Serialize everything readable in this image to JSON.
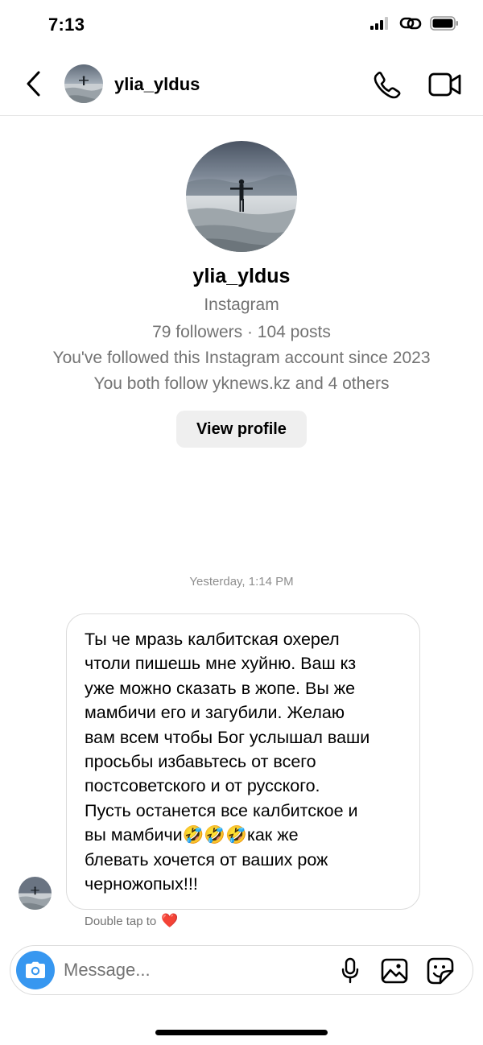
{
  "status_bar": {
    "time": "7:13"
  },
  "header": {
    "username": "ylia_yldus"
  },
  "profile": {
    "name": "ylia_yldus",
    "platform": "Instagram",
    "stats": "79 followers · 104 posts",
    "followed_since": "You've followed this Instagram account since 2023",
    "mutual": "You both follow yknews.kz and 4 others",
    "view_profile_label": "View profile"
  },
  "chat": {
    "timestamp": "Yesterday, 1:14 PM",
    "messages": [
      {
        "text": "Ты че мразь калбитская охерел\nчтоли пишешь мне хуйню. Ваш кз\nуже можно сказать в жопе. Вы же\nмамбичи его и загубили. Желаю\nвам всем чтобы Бог услышал ваши\nпросьбы избавьтесь от всего\nпостсоветского и от русского.\nПусть останется все калбитское и\nвы мамбичи🤣🤣🤣как же\nблевать хочется от ваших рож\nчерножопых!!!"
      }
    ],
    "double_tap_hint": "Double tap to",
    "double_tap_emoji": "❤️"
  },
  "composer": {
    "placeholder": "Message..."
  },
  "icons": {
    "back": "chevron-left-icon",
    "call": "phone-icon",
    "video": "video-camera-icon",
    "camera": "camera-icon",
    "mic": "microphone-icon",
    "gallery": "image-icon",
    "sticker": "sticker-icon"
  },
  "colors": {
    "accent": "#3797f0",
    "secondary_text": "#737373",
    "heart": "#ed4956"
  }
}
